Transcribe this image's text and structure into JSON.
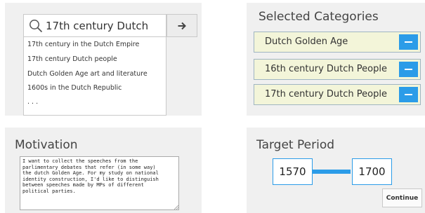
{
  "search": {
    "query": "17th century Dutch",
    "suggestions": [
      "17th century in the Dutch Empire",
      "17th century Dutch people",
      "Dutch Golden Age art and literature",
      "1600s in the Dutch Republic",
      ". . ."
    ],
    "search_icon": "search-icon",
    "go_icon": "arrow-right-icon"
  },
  "categories": {
    "title": "Selected Categories",
    "items": [
      "Dutch Golden Age",
      "16th century Dutch People",
      "17th century Dutch People"
    ],
    "remove_icon": "minus-icon"
  },
  "motivation": {
    "title": "Motivation",
    "text": "I want to collect the speeches from the\nparlimentary debates that refer (in some way)\nthe dutch Golden Age. For my study on national\nidentity construction, I'd like to distinguish\nbetween speeches made by MPs of different\npolitical parties."
  },
  "period": {
    "title": "Target Period",
    "start": "1570",
    "end": "1700",
    "continue_label": "Continue"
  },
  "colors": {
    "accent": "#2b9ce8",
    "panel_bg": "#f0f0f0",
    "category_bg": "#f3f5d9"
  }
}
